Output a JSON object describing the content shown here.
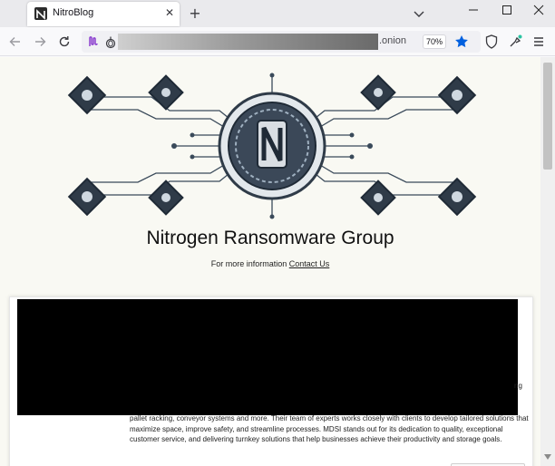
{
  "browser": {
    "tab": {
      "title": "NitroBlog"
    },
    "url": {
      "suffix": ".onion"
    },
    "zoom": "70%"
  },
  "page": {
    "site_title": "Nitrogen Ransomware Group",
    "contact": {
      "prefix": "For more information",
      "link_label": "Contact Us"
    },
    "post": {
      "visible_tail": "ng",
      "body": "pallet racking, conveyor systems and more. Their team of experts works closely with clients to develop tailored solutions that maximize space, improve safety, and streamline processes. MDSI stands out for its dedication to quality, exceptional customer service, and delivering turnkey solutions that help businesses achieve their productivity and storage goals."
    }
  },
  "icons": {
    "favicon": "nitrogen-logo-icon",
    "close": "close-icon",
    "new_tab": "plus-icon",
    "list_tabs": "chevron-down-icon",
    "back": "arrow-left-icon",
    "forward": "arrow-right-icon",
    "reload": "reload-icon",
    "extension": "extension-icon",
    "onion": "onion-icon",
    "bookmark": "star-icon",
    "shield": "shield-icon",
    "extensions2": "puzzle-icon",
    "menu": "hamburger-menu-icon"
  },
  "colors": {
    "bookmark_star": "#0060df",
    "page_bg": "#f9f9f3",
    "title": "#111111"
  }
}
